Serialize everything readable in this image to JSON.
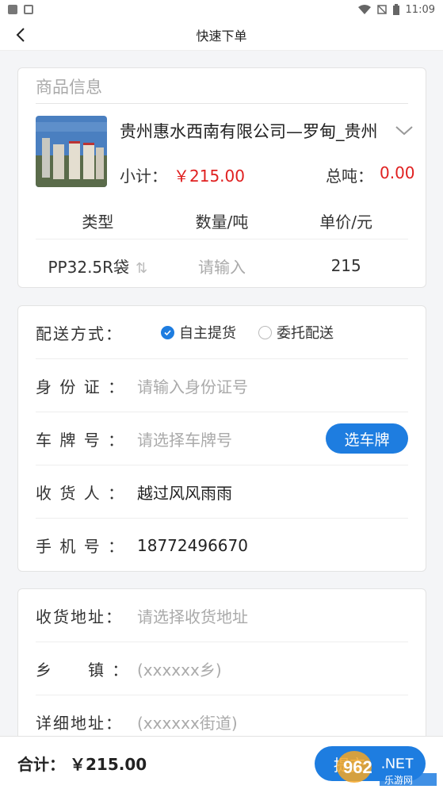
{
  "status_bar": {
    "time": "11:09",
    "icons": [
      "gallery-icon",
      "app-icon",
      "wifi-icon",
      "no-sim-icon",
      "battery-icon"
    ]
  },
  "nav": {
    "title": "快速下单",
    "back_icon": "chevron-left-icon"
  },
  "goods": {
    "section_title": "商品信息",
    "name": "贵州惠水西南有限公司—罗甸_贵州",
    "subtotal_label": "小计：",
    "subtotal_value": "￥215.00",
    "tons_label": "总吨：",
    "tons_value": "0.00",
    "table": {
      "headers": [
        "类型",
        "数量/吨",
        "单价/元"
      ],
      "row": {
        "type": "PP32.5R袋",
        "quantity_placeholder": "请输入",
        "unit_price": "215"
      }
    }
  },
  "delivery": {
    "method_label": "配送方式：",
    "options": [
      {
        "label": "自主提货",
        "selected": true
      },
      {
        "label": "委托配送",
        "selected": false
      }
    ],
    "id_label": "身 份 证 ：",
    "id_placeholder": "请输入身份证号",
    "plate_label": "车 牌 号 ：",
    "plate_placeholder": "请选择车牌号",
    "plate_button": "选车牌",
    "consignee_label": "收 货 人 ：",
    "consignee_value": "越过风风雨雨",
    "phone_label": "手 机 号 ：",
    "phone_value": "18772496670"
  },
  "address": {
    "address_label": "收货地址：",
    "address_placeholder": "请选择收货地址",
    "town_label": "乡　　镇 ：",
    "town_placeholder": "(xxxxxx乡)",
    "detail_label": "详细地址：",
    "detail_placeholder": "(xxxxxx街道)"
  },
  "footer": {
    "total_label": "合计：",
    "total_value": "￥215.00",
    "submit_label": "提交"
  },
  "colors": {
    "accent": "#1e7de0",
    "price_red": "#e02020"
  }
}
